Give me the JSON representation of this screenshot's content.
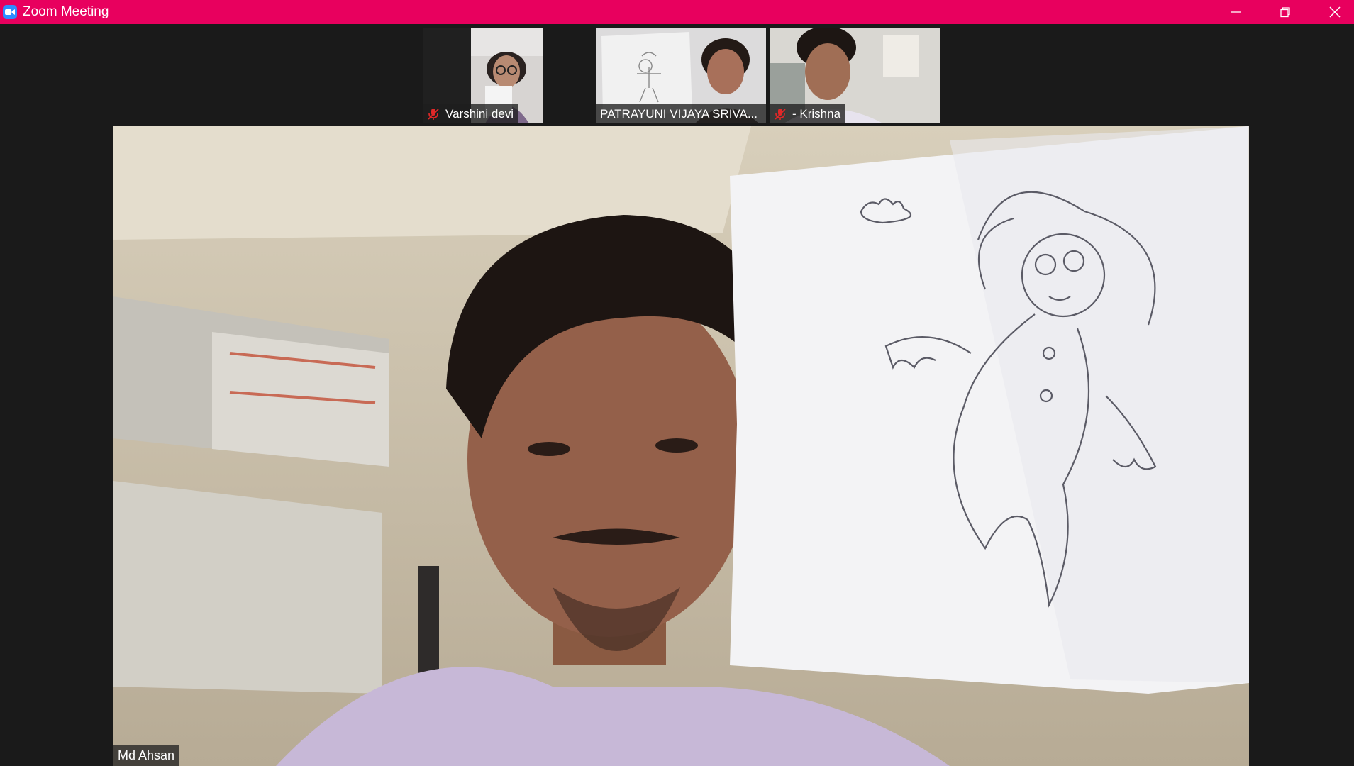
{
  "window": {
    "title": "Zoom Meeting",
    "app_icon": "zoom-camera-icon",
    "controls": [
      "minimize-icon",
      "restore-icon",
      "close-icon"
    ],
    "title_bar_color": "#e8005e"
  },
  "gallery": {
    "participants": [
      {
        "name": "Varshini devi",
        "muted": true
      },
      {
        "name": "PATRAYUNI VIJAYA SRIVA...",
        "muted": false
      },
      {
        "name": "- Krishna",
        "muted": true
      }
    ]
  },
  "active_speaker": {
    "name": "Md Ahsan"
  },
  "colors": {
    "muted_icon": "#e02828",
    "background": "#1a1a1a"
  }
}
